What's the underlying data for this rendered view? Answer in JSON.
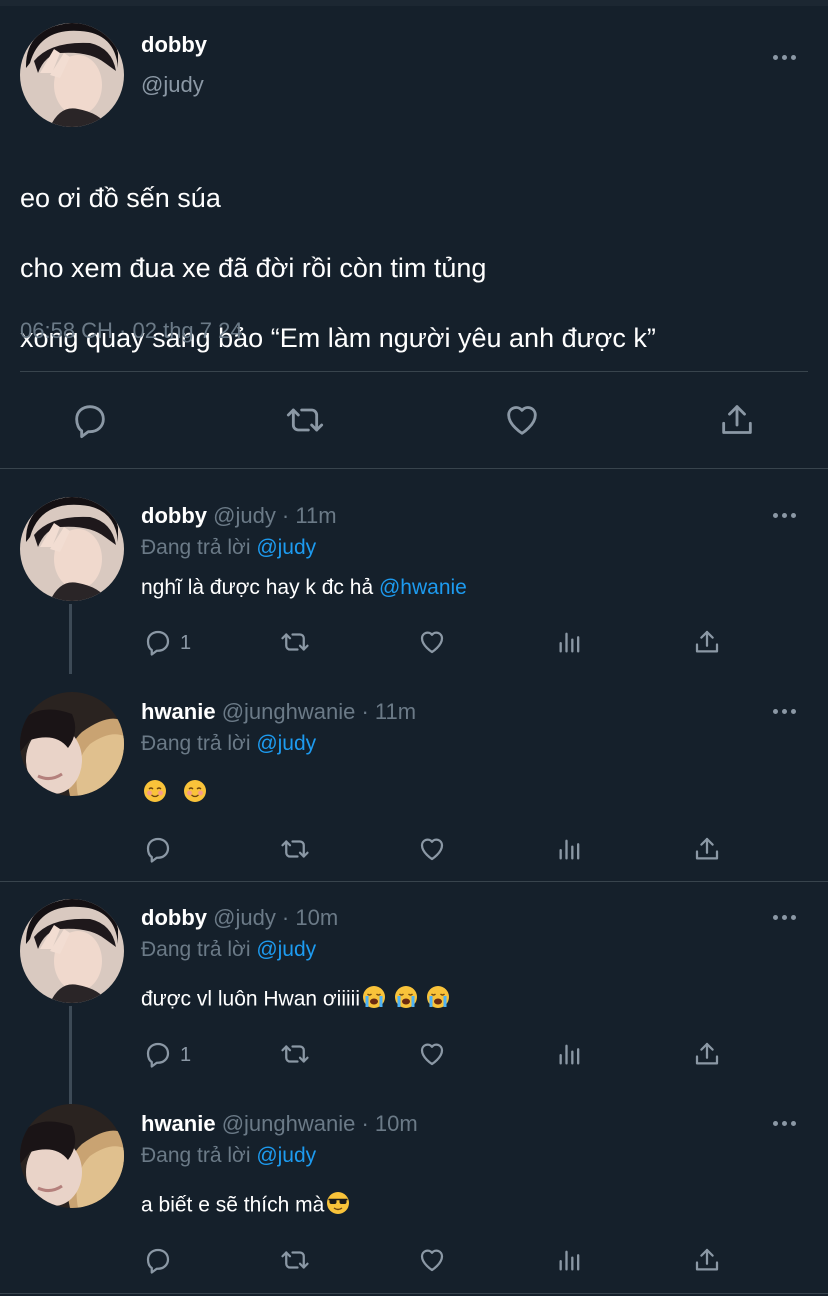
{
  "main_tweet": {
    "name": "dobby",
    "handle": "@judy",
    "text_lines": [
      "eo ơi đồ sến súa",
      "cho xem đua xe đã đời rồi còn tim tủng",
      "xong quay sang bảo “Em làm người yêu anh được k”"
    ],
    "timestamp": "06:58 CH · 02 thg 7 24",
    "actions": [
      "reply-icon",
      "retweet-icon",
      "like-icon",
      "share-icon"
    ]
  },
  "replies": [
    {
      "name": "dobby",
      "meta": "@judy · 11m",
      "replying_prefix": "Đang trả lời",
      "replying_to": "@judy",
      "text": "nghĩ là được hay k đc hả",
      "text_mention": "@hwanie",
      "reply_count": "1"
    },
    {
      "name": "hwanie",
      "meta": "@junghwanie · 11m",
      "replying_prefix": "Đang trả lời",
      "replying_to": "@judy",
      "emojis": [
        "blushing-smile-emoji",
        "blushing-smile-emoji"
      ]
    },
    {
      "name": "dobby",
      "meta": "@judy · 10m",
      "replying_prefix": "Đang trả lời",
      "replying_to": "@judy",
      "text": "được vl luôn Hwan ơiiiii",
      "emojis": [
        "crying-face-emoji",
        "crying-face-emoji",
        "crying-face-emoji"
      ],
      "reply_count": "1"
    },
    {
      "name": "hwanie",
      "meta": "@junghwanie · 10m",
      "replying_prefix": "Đang trả lời",
      "replying_to": "@judy",
      "text": "a biết e sẽ thích mà",
      "emojis": [
        "sunglasses-face-emoji"
      ]
    }
  ],
  "colors": {
    "background": "#15202b",
    "accent": "#1d9bf0",
    "secondary_text": "#8b98a5",
    "divider": "#38444d"
  }
}
